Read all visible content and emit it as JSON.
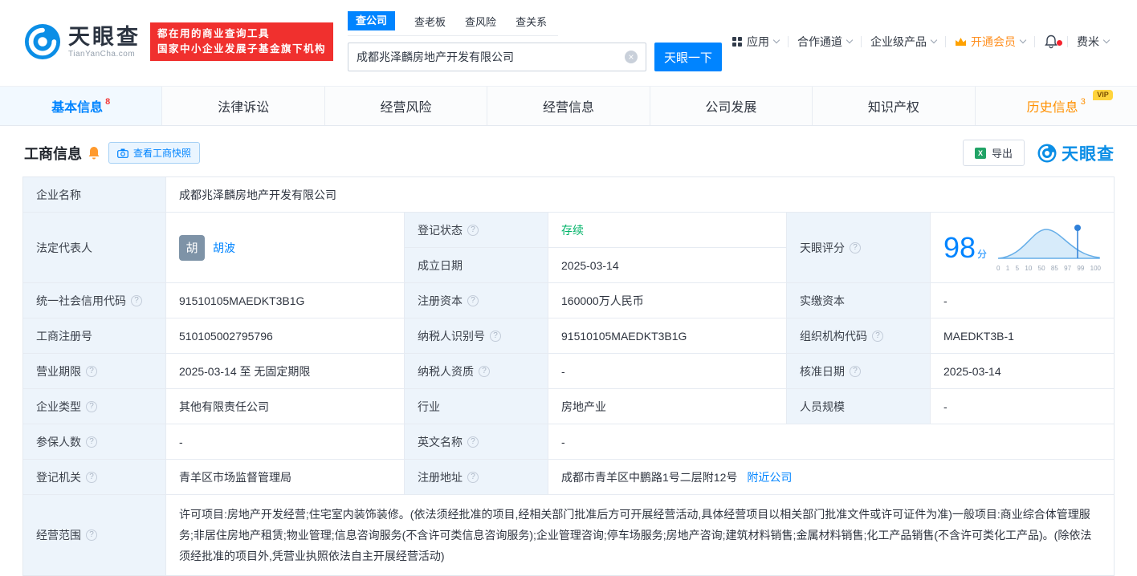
{
  "icons": {
    "help": "?",
    "clear": "×",
    "excel": "X"
  },
  "header": {
    "logo": {
      "brand": "天眼查",
      "domain": "TianYanCha.com"
    },
    "slogan_line1": "都在用的商业查询工具",
    "slogan_line2": "国家中小企业发展子基金旗下机构",
    "search_tabs": [
      {
        "label": "查公司"
      },
      {
        "label": "查老板"
      },
      {
        "label": "查风险"
      },
      {
        "label": "查关系"
      }
    ],
    "search_value": "成都兆泽麟房地产开发有限公司",
    "search_button": "天眼一下",
    "nav": [
      {
        "label": "应用"
      },
      {
        "label": "合作通道"
      },
      {
        "label": "企业级产品"
      },
      {
        "label": "开通会员"
      },
      {
        "label": "费米"
      }
    ]
  },
  "tabs": [
    {
      "label": "基本信息",
      "count": "8"
    },
    {
      "label": "法律诉讼"
    },
    {
      "label": "经营风险"
    },
    {
      "label": "经营信息"
    },
    {
      "label": "公司发展"
    },
    {
      "label": "知识产权"
    },
    {
      "label": "历史信息",
      "count": "3",
      "vip_label": "VIP"
    }
  ],
  "section": {
    "title": "工商信息",
    "snapshot_button": "查看工商快照",
    "export_button": "导出",
    "watermark": "天眼查"
  },
  "info": {
    "company_name": {
      "label": "企业名称",
      "value": "成都兆泽麟房地产开发有限公司"
    },
    "legal_rep": {
      "label": "法定代表人",
      "avatar": "胡",
      "value": "胡波"
    },
    "reg_status": {
      "label": "登记状态",
      "value": "存续"
    },
    "establish_date": {
      "label": "成立日期",
      "value": "2025-03-14"
    },
    "score": {
      "label": "天眼评分",
      "value": "98",
      "unit": "分",
      "axis": [
        "0",
        "1",
        "5",
        "10",
        "50",
        "85",
        "97",
        "99",
        "100"
      ]
    },
    "credit_code": {
      "label": "统一社会信用代码",
      "value": "91510105MAEDKT3B1G"
    },
    "reg_capital": {
      "label": "注册资本",
      "value": "160000万人民币"
    },
    "paid_capital": {
      "label": "实缴资本",
      "value": "-"
    },
    "reg_number": {
      "label": "工商注册号",
      "value": "510105002795796"
    },
    "taxpayer_id": {
      "label": "纳税人识别号",
      "value": "91510105MAEDKT3B1G"
    },
    "org_code": {
      "label": "组织机构代码",
      "value": "MAEDKT3B-1"
    },
    "business_term": {
      "label": "营业期限",
      "value": "2025-03-14 至 无固定期限"
    },
    "taxpayer_quality": {
      "label": "纳税人资质",
      "value": "-"
    },
    "approval_date": {
      "label": "核准日期",
      "value": "2025-03-14"
    },
    "company_type": {
      "label": "企业类型",
      "value": "其他有限责任公司"
    },
    "industry": {
      "label": "行业",
      "value": "房地产业"
    },
    "staff_size": {
      "label": "人员规模",
      "value": "-"
    },
    "insured_count": {
      "label": "参保人数",
      "value": "-"
    },
    "english_name": {
      "label": "英文名称",
      "value": "-"
    },
    "reg_authority": {
      "label": "登记机关",
      "value": "青羊区市场监督管理局"
    },
    "reg_address": {
      "label": "注册地址",
      "value": "成都市青羊区中鹏路1号二层附12号",
      "nearby_link": "附近公司"
    },
    "business_scope": {
      "label": "经营范围",
      "value": "许可项目:房地产开发经营;住宅室内装饰装修。(依法须经批准的项目,经相关部门批准后方可开展经营活动,具体经营项目以相关部门批准文件或许可证件为准)一般项目:商业综合体管理服务;非居住房地产租赁;物业管理;信息咨询服务(不含许可类信息咨询服务);企业管理咨询;停车场服务;房地产咨询;建筑材料销售;金属材料销售;化工产品销售(不含许可类化工产品)。(除依法须经批准的项目外,凭营业执照依法自主开展经营活动)"
    }
  },
  "colors": {
    "accent": "#0084ff",
    "status_green": "#00b368",
    "vip_orange": "#ff9000"
  }
}
